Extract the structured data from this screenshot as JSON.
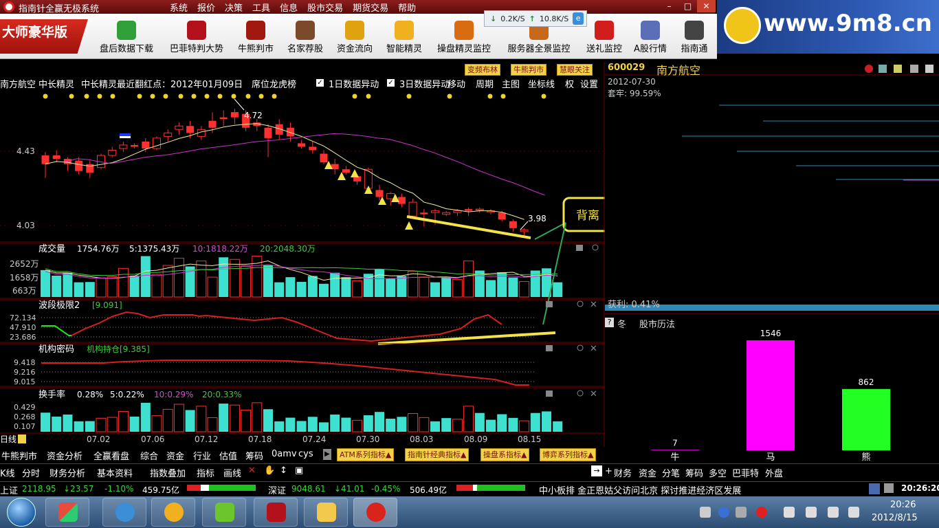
{
  "window": {
    "title": "指南针全赢无极系统",
    "menu": [
      "系统",
      "报价",
      "决策",
      "工具",
      "信息",
      "股市交易",
      "期货交易",
      "帮助"
    ],
    "net_down": "0.2K/S",
    "net_up": "10.8K/S",
    "minimize": "–",
    "restore": "□",
    "close": "✕"
  },
  "watermark": "www.9m8.cn",
  "toolbar": {
    "edition": "大师豪华版",
    "buttons": [
      {
        "label": "盘后数据下载",
        "icon": "download-icon",
        "color": "#2f9f3a"
      },
      {
        "label": "巴菲特判大势",
        "icon": "buffett-icon",
        "color": "#b3121c"
      },
      {
        "label": "牛熊判市",
        "icon": "bull-bear-icon",
        "color": "#a0180f"
      },
      {
        "label": "名家荐股",
        "icon": "expert-icon",
        "color": "#7a4a2a"
      },
      {
        "label": "资金流向",
        "icon": "money-flow-icon",
        "color": "#e0a310"
      },
      {
        "label": "智能精灵",
        "icon": "genie-icon",
        "color": "#f0b020"
      },
      {
        "label": "操盘精灵监控",
        "icon": "trade-monitor-icon",
        "color": "#d96b10"
      },
      {
        "label": "服务器全景监控",
        "icon": "server-monitor-icon",
        "color": "#c8691a"
      },
      {
        "label": "送礼监控",
        "icon": "gift-icon",
        "color": "#d21d1d"
      },
      {
        "label": "A股行情",
        "icon": "a-share-icon",
        "color": "#5a6fb8"
      },
      {
        "label": "指南通",
        "icon": "compass-icon",
        "color": "#444"
      }
    ]
  },
  "chart": {
    "stock_name": "南方航空",
    "info_items": [
      "中长精灵",
      "中长精灵最近翻红点：2012年01月09日",
      "席位龙虎榜",
      "1日数据异动",
      "3日数据异动",
      "移动",
      "周期",
      "主图",
      "坐标线",
      "权",
      "设置"
    ],
    "tag_buttons": [
      "变频布林",
      "牛熊判市",
      "慧眼关注"
    ],
    "price_high_label": "4.72",
    "price_low_label": "3.98",
    "y_labels_price": [
      "4.43",
      "4.03"
    ],
    "divergence_label": "背离",
    "volume": {
      "title": "成交量",
      "value": "1754.76万",
      "ma5": "5:1375.43万",
      "ma10": "10:1818.22万",
      "ma20": "20:2048.30万",
      "y_labels": [
        "2652万",
        "1658万",
        "663万"
      ],
      "bars": [
        1830,
        1450,
        1650,
        1000,
        1020,
        1300,
        1380,
        1950,
        1450,
        2780,
        1540,
        2150,
        2640,
        2080,
        2450,
        1350,
        2700,
        2560,
        2080,
        2780,
        2160,
        1000,
        1350,
        1030,
        1430,
        900,
        1650,
        1350,
        1100,
        1580,
        1900,
        1250,
        1430,
        1750,
        1360,
        1000,
        1310,
        1200,
        2450,
        1800,
        1150,
        1680,
        1330,
        1050,
        1800,
        1950,
        1000
      ]
    },
    "wave": {
      "title": "波段极限2",
      "value": "[9.091]",
      "y_labels": [
        "72.134",
        "47.910",
        "23.686"
      ]
    },
    "inst": {
      "title": "机构密码",
      "value": "机构持仓[9.385]",
      "y_labels": [
        "9.418",
        "9.216",
        "9.015"
      ]
    },
    "turnover": {
      "title": "换手率",
      "value": "0.28%",
      "ma5": "5:0.22%",
      "ma10": "10:0.29%",
      "ma20": "20:0.33%",
      "y_labels": [
        "0.429",
        "0.268",
        "0.107"
      ]
    },
    "x_labels": [
      "07.02",
      "07.06",
      "07.12",
      "07.18",
      "07.24",
      "07.30",
      "08.03",
      "08.09",
      "08.15"
    ],
    "period_label": "日线"
  },
  "candles": [
    [
      4.45,
      4.47,
      4.32,
      4.4
    ],
    [
      4.45,
      4.48,
      4.41,
      4.43
    ],
    [
      4.43,
      4.44,
      4.36,
      4.4
    ],
    [
      4.42,
      4.44,
      4.34,
      4.36
    ],
    [
      4.4,
      4.42,
      4.32,
      4.35
    ],
    [
      4.38,
      4.46,
      4.37,
      4.45
    ],
    [
      4.45,
      4.5,
      4.44,
      4.48
    ],
    [
      4.49,
      4.53,
      4.47,
      4.51
    ],
    [
      4.51,
      4.52,
      4.49,
      4.5
    ],
    [
      4.53,
      4.55,
      4.47,
      4.49
    ],
    [
      4.49,
      4.56,
      4.48,
      4.55
    ],
    [
      4.56,
      4.6,
      4.53,
      4.58
    ],
    [
      4.6,
      4.64,
      4.57,
      4.62
    ],
    [
      4.62,
      4.65,
      4.55,
      4.58
    ],
    [
      4.56,
      4.62,
      4.54,
      4.6
    ],
    [
      4.65,
      4.7,
      4.58,
      4.61
    ],
    [
      4.67,
      4.71,
      4.62,
      4.66
    ],
    [
      4.7,
      4.72,
      4.63,
      4.67
    ],
    [
      4.69,
      4.71,
      4.59,
      4.61
    ],
    [
      4.64,
      4.66,
      4.59,
      4.62
    ],
    [
      4.61,
      4.63,
      4.44,
      4.55
    ],
    [
      4.63,
      4.66,
      4.54,
      4.57
    ],
    [
      4.61,
      4.64,
      4.53,
      4.56
    ],
    [
      4.52,
      4.54,
      4.49,
      4.5
    ],
    [
      4.5,
      4.53,
      4.46,
      4.48
    ],
    [
      4.46,
      4.48,
      4.4,
      4.41
    ],
    [
      4.4,
      4.43,
      4.34,
      4.37
    ],
    [
      4.37,
      4.39,
      4.34,
      4.35
    ],
    [
      4.33,
      4.34,
      4.28,
      4.3
    ],
    [
      4.26,
      4.38,
      4.24,
      4.37
    ],
    [
      4.25,
      4.28,
      4.19,
      4.21
    ],
    [
      4.2,
      4.24,
      4.16,
      4.23
    ],
    [
      4.21,
      4.23,
      4.15,
      4.17
    ],
    [
      4.1,
      4.2,
      4.09,
      4.18
    ],
    [
      4.12,
      4.14,
      4.04,
      4.11
    ],
    [
      4.12,
      4.14,
      4.05,
      4.13
    ],
    [
      4.11,
      4.13,
      4.1,
      4.12
    ],
    [
      4.12,
      4.14,
      4.1,
      4.13
    ],
    [
      4.14,
      4.15,
      4.1,
      4.13
    ],
    [
      4.14,
      4.15,
      4.12,
      4.14
    ],
    [
      4.13,
      4.14,
      4.11,
      4.13
    ],
    [
      4.12,
      4.13,
      4.07,
      4.08
    ],
    [
      4.07,
      4.08,
      4.01,
      4.03
    ],
    [
      4.01,
      4.03,
      3.98,
      4.02
    ]
  ],
  "right_panel": {
    "code": "600029",
    "name": "南方航空",
    "date": "2012-07-30",
    "trapped": "套牢: 99.59%",
    "profit": "获利: 0.41%",
    "tab_icon": "?",
    "tab_winter": "冬",
    "tab_calendar": "股市历法",
    "bars": [
      {
        "label": "牛",
        "value": 7,
        "color": "#ff00ff"
      },
      {
        "label": "马",
        "value": 1546,
        "color": "#ff00ff"
      },
      {
        "label": "熊",
        "value": 862,
        "color": "#22ff22"
      }
    ]
  },
  "bottom_tabs": [
    "牛熊判市",
    "资金分析",
    "全赢看盘",
    "综合",
    "资金",
    "行业",
    "估值",
    "筹码",
    "0amv",
    "cys"
  ],
  "series_buttons": [
    "ATM系列指标▲",
    "指南针经典指标▲",
    "操盘系指标▲",
    "博弈系列指标▲"
  ],
  "toolbar2": {
    "left": [
      "K线",
      "分时",
      "财务分析",
      "基本资料",
      "指数叠加",
      "指标",
      "画线"
    ],
    "right": [
      "财务",
      "资金",
      "分笔",
      "筹码",
      "多空",
      "巴菲特",
      "外盘"
    ]
  },
  "statusbar": {
    "sh_label": "上证",
    "sh_value": "2118.95",
    "sh_change": "↓23.57",
    "sh_pct": "-1.10%",
    "sh_amount": "459.75亿",
    "sz_label": "深证",
    "sz_value": "9048.61",
    "sz_change": "↓41.01",
    "sz_pct": "-0.45%",
    "sz_amount": "506.49亿",
    "news": "中小板排 金正恩姑父访问北京 探讨推进经济区发展",
    "time": "20:26:20"
  },
  "taskbar": {
    "time": "20:26",
    "date": "2012/8/15"
  }
}
